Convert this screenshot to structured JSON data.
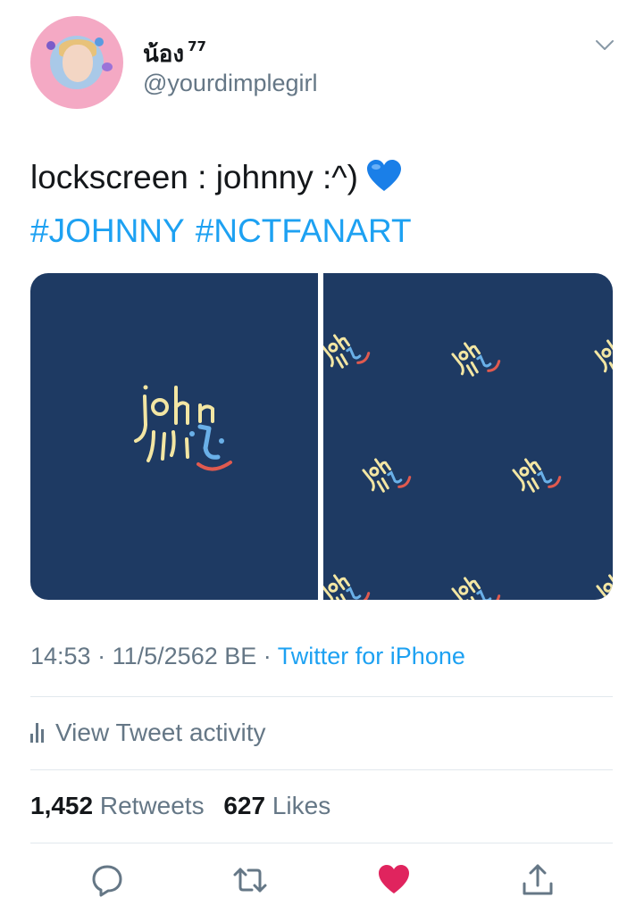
{
  "user": {
    "display_name": "น้อง",
    "name_suffix": "77",
    "handle": "@yourdimplegirl"
  },
  "tweet": {
    "text": "lockscreen : johnny :^)",
    "emoji": "blue-heart",
    "hashtags": [
      "#JOHNNY",
      "#NCTFANART"
    ]
  },
  "media": {
    "images": [
      {
        "name": "johnny-lockscreen-single",
        "artwork_text": "john ny"
      },
      {
        "name": "johnny-lockscreen-pattern",
        "artwork_text": "john ny"
      }
    ]
  },
  "meta": {
    "time": "14:53",
    "date": "11/5/2562 BE",
    "source": "Twitter for iPhone",
    "separator": "·"
  },
  "activity": {
    "label": "View Tweet activity"
  },
  "stats": {
    "retweets_count": "1,452",
    "retweets_label": "Retweets",
    "likes_count": "627",
    "likes_label": "Likes"
  },
  "actions": [
    {
      "name": "reply-icon"
    },
    {
      "name": "retweet-icon"
    },
    {
      "name": "like-icon",
      "active": true
    },
    {
      "name": "share-icon"
    }
  ],
  "colors": {
    "link": "#1da1f2",
    "secondary_text": "#657786",
    "like_active": "#e0245e",
    "artwork_background": "#1e3a63",
    "artwork_yellow": "#f3e6a3",
    "artwork_blue": "#6ab0e8",
    "artwork_red": "#e05a4f"
  }
}
